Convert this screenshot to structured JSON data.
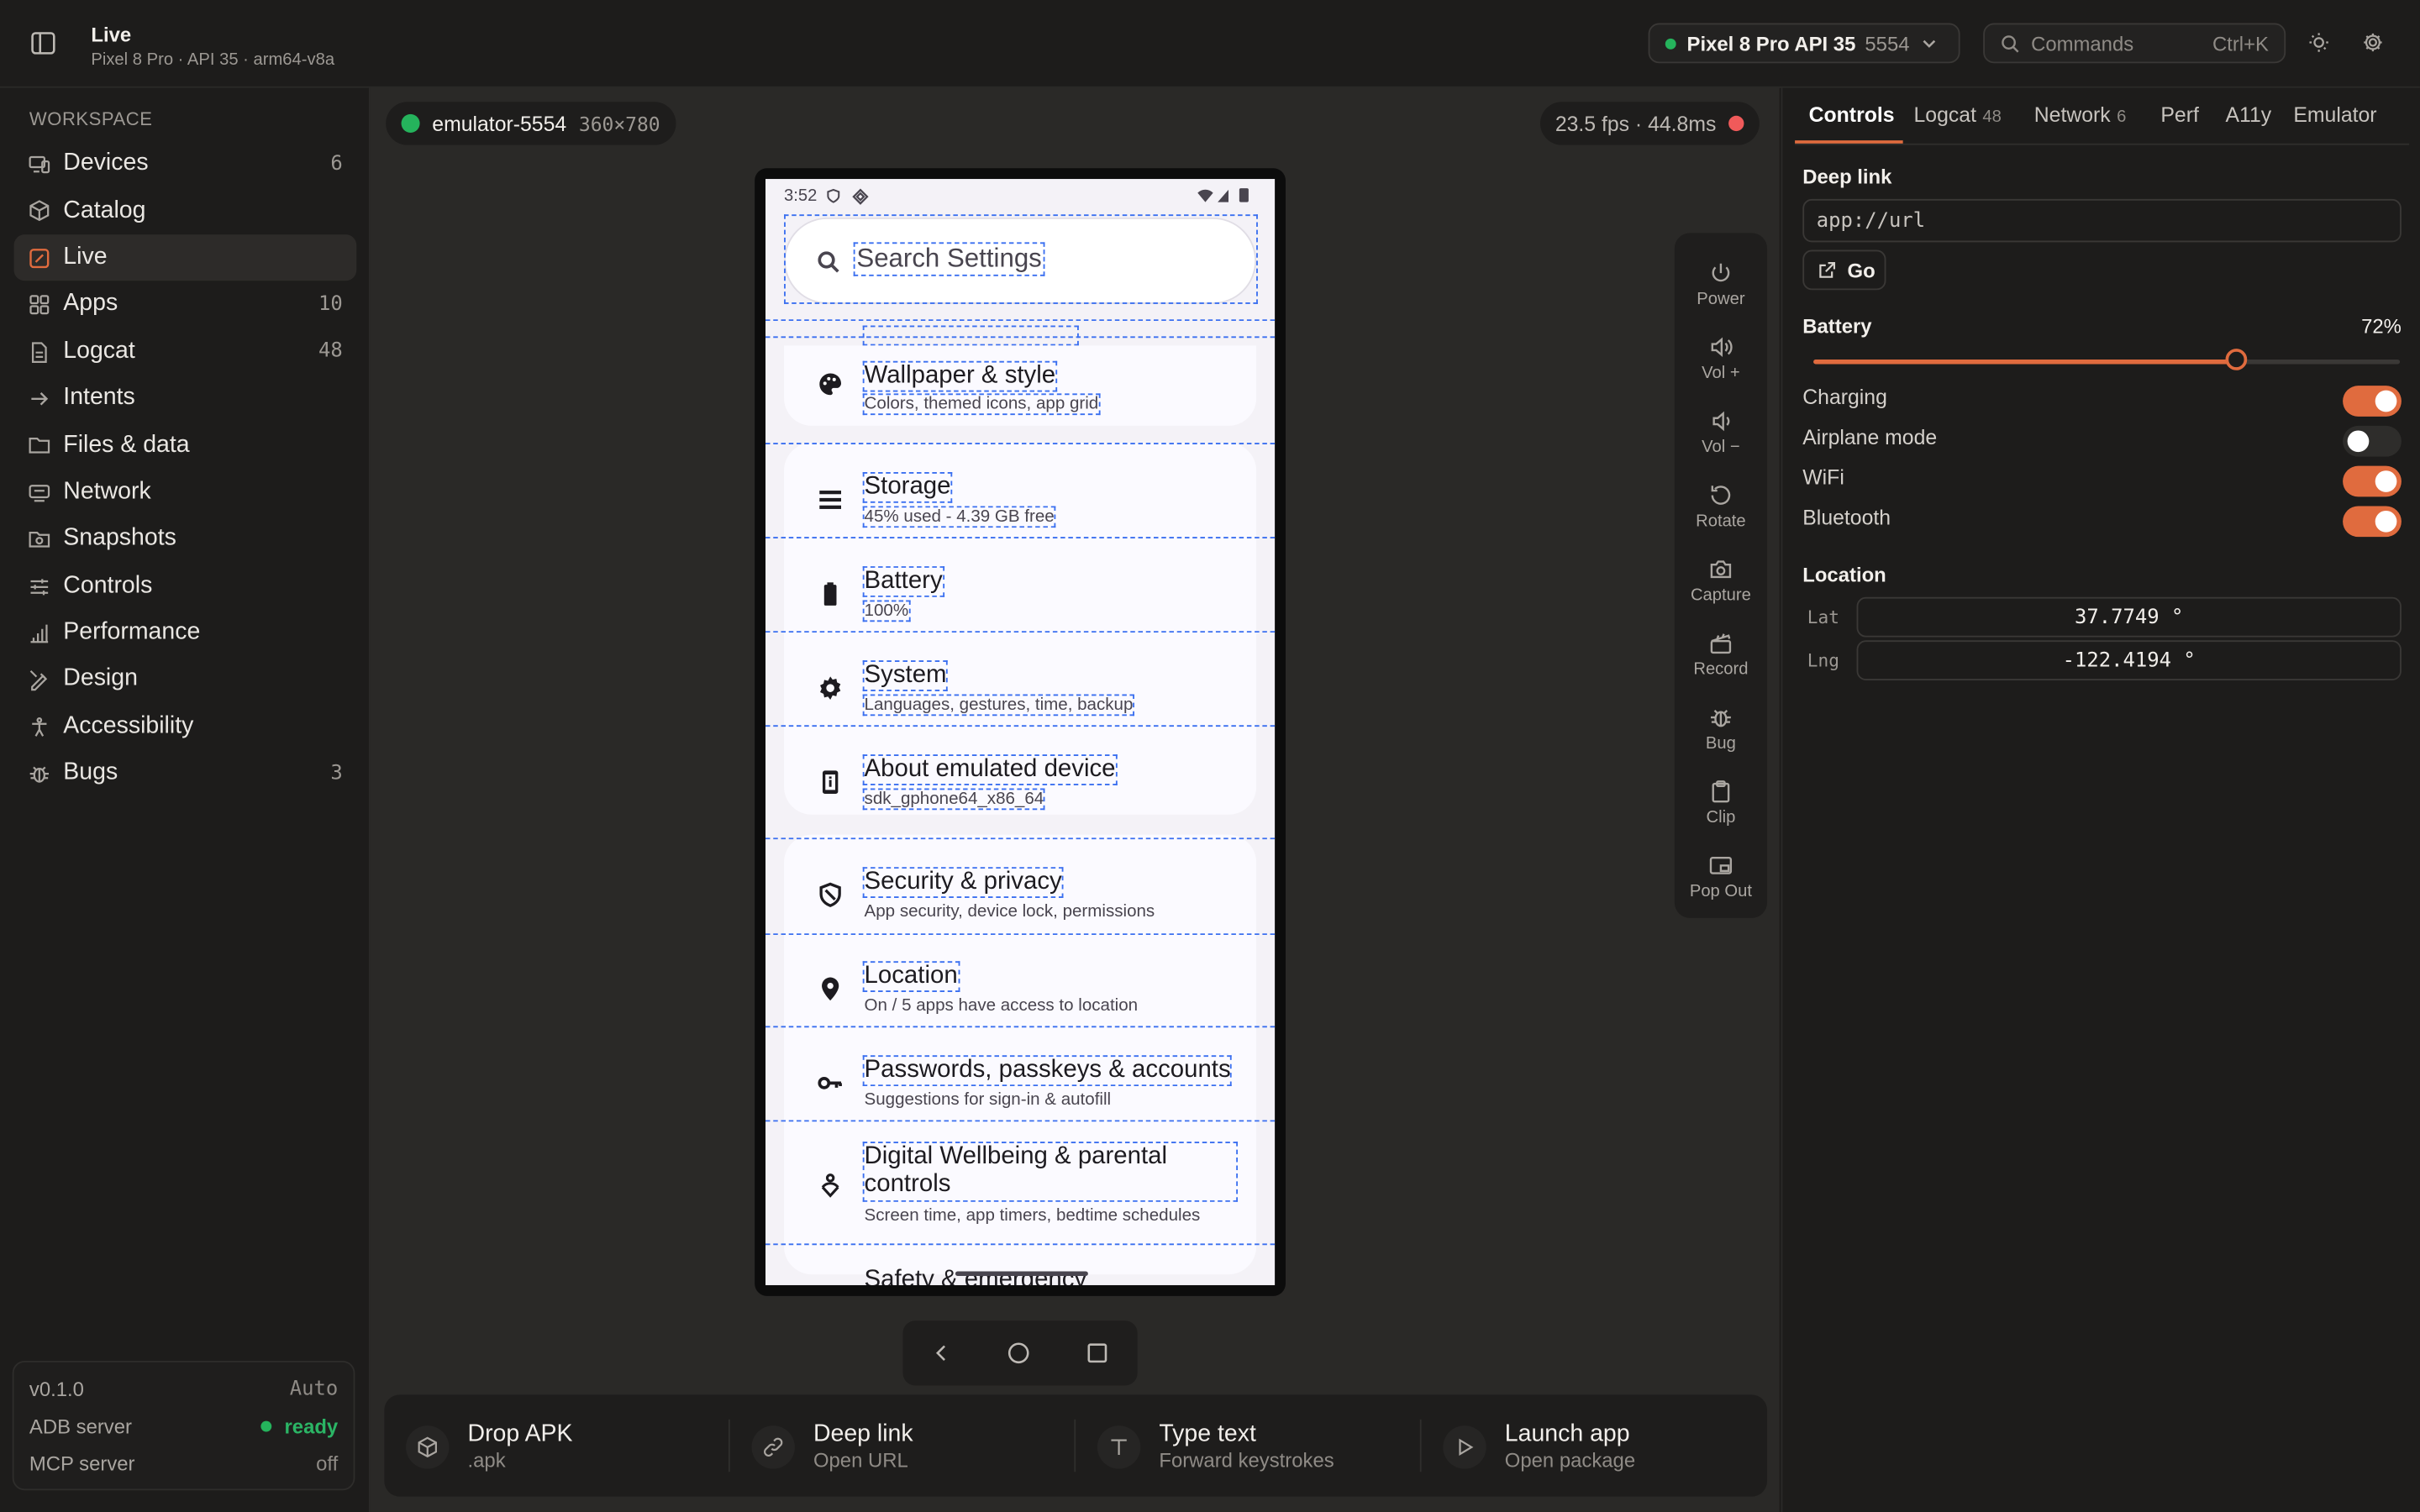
{
  "header": {
    "title": "Live",
    "subtitle": "Pixel 8 Pro · API 35 · arm64-v8a",
    "device_name": "Pixel 8 Pro API 35",
    "device_port": "5554",
    "commands_placeholder": "Commands",
    "commands_shortcut": "Ctrl+K"
  },
  "sidebar": {
    "section_label": "WORKSPACE",
    "items": [
      {
        "label": "Devices",
        "count": "6"
      },
      {
        "label": "Catalog",
        "count": ""
      },
      {
        "label": "Live",
        "count": ""
      },
      {
        "label": "Apps",
        "count": "10"
      },
      {
        "label": "Logcat",
        "count": "48"
      },
      {
        "label": "Intents",
        "count": ""
      },
      {
        "label": "Files & data",
        "count": ""
      },
      {
        "label": "Network",
        "count": ""
      },
      {
        "label": "Snapshots",
        "count": ""
      },
      {
        "label": "Controls",
        "count": ""
      },
      {
        "label": "Performance",
        "count": ""
      },
      {
        "label": "Design",
        "count": ""
      },
      {
        "label": "Accessibility",
        "count": ""
      },
      {
        "label": "Bugs",
        "count": "3"
      }
    ],
    "active_item": "Live",
    "status": {
      "version": "v0.1.0",
      "theme": "Auto",
      "adb_label": "ADB server",
      "adb_value": "ready",
      "mcp_label": "MCP server",
      "mcp_value": "off"
    }
  },
  "viewer": {
    "emulator_name": "emulator-5554",
    "emulator_size": "360×780",
    "perf": "23.5 fps · 44.8ms"
  },
  "phone": {
    "time": "3:52",
    "search_placeholder": "Search Settings",
    "settings": [
      {
        "title": "Wallpaper & style",
        "subtitle": "Colors, themed icons, app grid",
        "icon": "palette-icon"
      },
      {
        "title": "Storage",
        "subtitle": "45% used - 4.39 GB free",
        "icon": "storage-icon"
      },
      {
        "title": "Battery",
        "subtitle": "100%",
        "icon": "battery-icon"
      },
      {
        "title": "System",
        "subtitle": "Languages, gestures, time, backup",
        "icon": "gear-icon"
      },
      {
        "title": "About emulated device",
        "subtitle": "sdk_gphone64_x86_64",
        "icon": "phone-info-icon"
      },
      {
        "title": "Security & privacy",
        "subtitle": "App security, device lock, permissions",
        "icon": "shield-icon"
      },
      {
        "title": "Location",
        "subtitle": "On / 5 apps have access to location",
        "icon": "location-pin-icon"
      },
      {
        "title": "Passwords, passkeys & accounts",
        "subtitle": "Suggestions for sign-in & autofill",
        "icon": "key-icon"
      },
      {
        "title": "Digital Wellbeing & parental controls",
        "subtitle": "Screen time, app timers, bedtime schedules",
        "icon": "wellbeing-icon"
      },
      {
        "title": "Safety & emergency",
        "subtitle": "",
        "icon": "emergency-icon"
      }
    ]
  },
  "tools": [
    {
      "label": "Power",
      "icon": "power-icon"
    },
    {
      "label": "Vol +",
      "icon": "volume-up-icon"
    },
    {
      "label": "Vol −",
      "icon": "volume-down-icon"
    },
    {
      "label": "Rotate",
      "icon": "rotate-icon"
    },
    {
      "label": "Capture",
      "icon": "camera-icon"
    },
    {
      "label": "Record",
      "icon": "clapper-icon"
    },
    {
      "label": "Bug",
      "icon": "bug-icon"
    },
    {
      "label": "Clip",
      "icon": "clipboard-icon"
    },
    {
      "label": "Pop Out",
      "icon": "pop-out-icon"
    }
  ],
  "actions": [
    {
      "title": "Drop APK",
      "subtitle": ".apk",
      "icon": "package-icon"
    },
    {
      "title": "Deep link",
      "subtitle": "Open URL",
      "icon": "link-icon"
    },
    {
      "title": "Type text",
      "subtitle": "Forward keystrokes",
      "icon": "text-icon"
    },
    {
      "title": "Launch app",
      "subtitle": "Open package",
      "icon": "play-icon"
    }
  ],
  "panel": {
    "tabs": [
      {
        "label": "Controls",
        "badge": ""
      },
      {
        "label": "Logcat",
        "badge": "48"
      },
      {
        "label": "Network",
        "badge": "6"
      },
      {
        "label": "Perf",
        "badge": ""
      },
      {
        "label": "A11y",
        "badge": ""
      },
      {
        "label": "Emulator",
        "badge": ""
      }
    ],
    "active_tab": "Controls",
    "deep_link_label": "Deep link",
    "deep_link_placeholder": "app://url",
    "go_label": "Go",
    "battery_label": "Battery",
    "battery_value": "72%",
    "battery_level": 0.72,
    "toggles": [
      {
        "label": "Charging",
        "on": true
      },
      {
        "label": "Airplane mode",
        "on": false
      },
      {
        "label": "WiFi",
        "on": true
      },
      {
        "label": "Bluetooth",
        "on": true
      }
    ],
    "location_label": "Location",
    "lat_label": "Lat",
    "lat_value": "37.7749 °",
    "lng_label": "Lng",
    "lng_value": "-122.4194 °"
  },
  "colors": {
    "accent": "#e06b3e",
    "ready": "#2bb565",
    "record": "#f05a5a",
    "selection": "#3a6ff0"
  }
}
